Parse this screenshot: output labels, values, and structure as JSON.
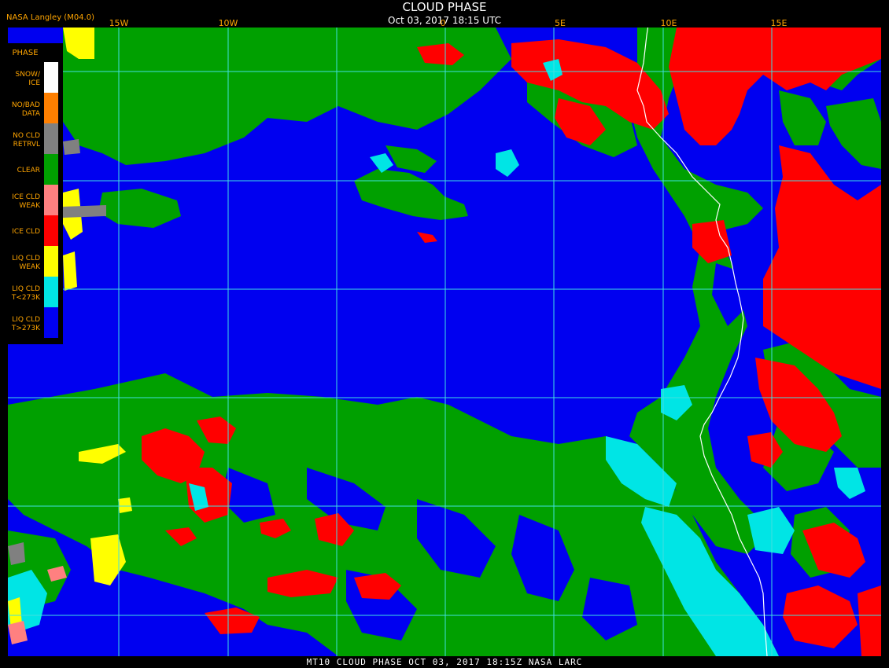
{
  "header": {
    "title": "CLOUD PHASE",
    "timestamp": "Oct 03, 2017 18:15 UTC",
    "producer": "NASA Langley (M04.0)"
  },
  "longitude_labels": [
    "15W",
    "10W",
    "0",
    "5E",
    "10E",
    "15E"
  ],
  "legend": {
    "title": "PHASE",
    "items": [
      {
        "label": "SNOW/\nICE",
        "color": "#ffffff"
      },
      {
        "label": "NO/BAD\nDATA",
        "color": "#ff7f00"
      },
      {
        "label": "NO CLD\nRETRVL",
        "color": "#808080"
      },
      {
        "label": "CLEAR",
        "color": "#00a000"
      },
      {
        "label": "ICE CLD\nWEAK",
        "color": "#ff8080"
      },
      {
        "label": "ICE CLD",
        "color": "#ff0000"
      },
      {
        "label": "LIQ CLD\nWEAK",
        "color": "#ffff00"
      },
      {
        "label": "LIQ CLD\nT<273K",
        "color": "#00e5e5"
      },
      {
        "label": "LIQ CLD\nT>273K",
        "color": "#0000f0"
      }
    ]
  },
  "footer": "MT10  CLOUD PHASE  OCT 03, 2017 18:15Z  NASA LARC",
  "colors": {
    "background": "#000000",
    "grid": "#40e0e0",
    "coastline": "#ffffff",
    "label_orange": "#ffa500"
  }
}
